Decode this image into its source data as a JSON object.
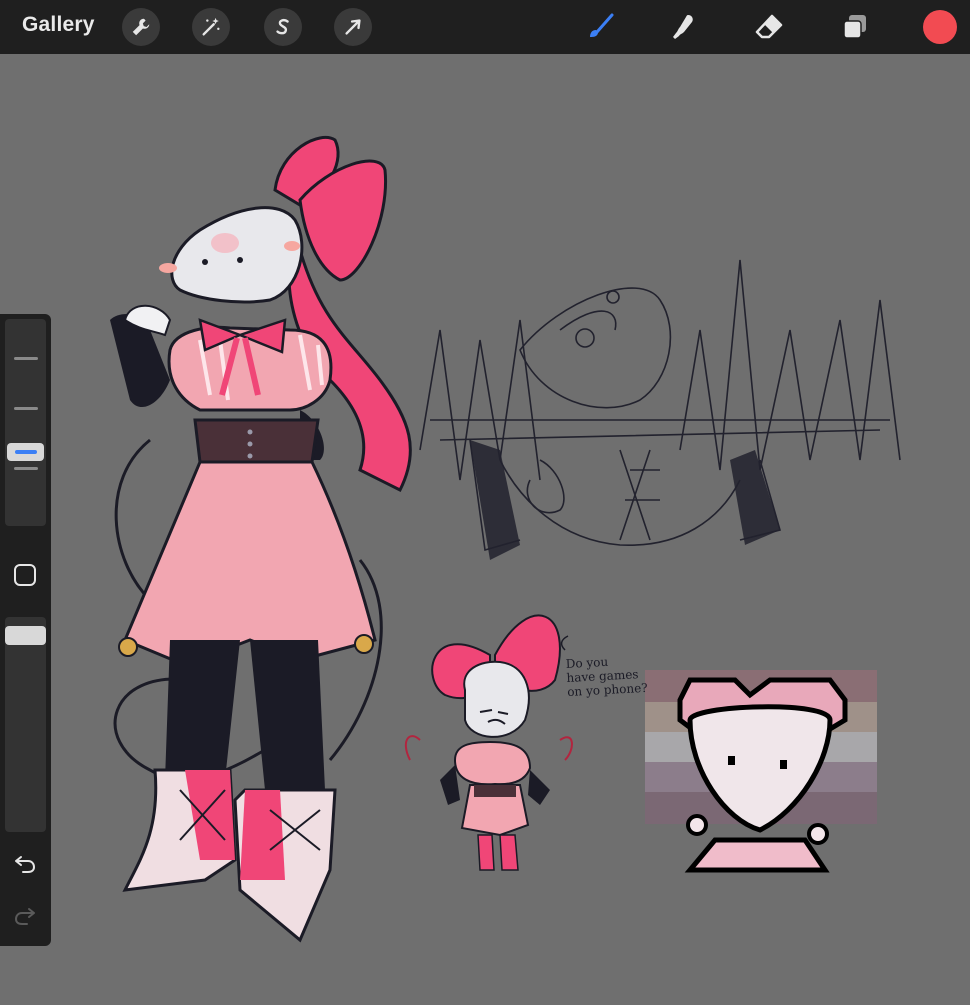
{
  "toolbar": {
    "gallery_label": "Gallery",
    "left_tools": [
      "wrench-icon",
      "magic-wand-icon",
      "selection-icon",
      "transform-arrow-icon"
    ],
    "right_tools": [
      "brush-icon",
      "smudge-icon",
      "eraser-icon",
      "layers-icon"
    ],
    "active_tool": "brush-icon",
    "brush_color": "#3b7ff5",
    "current_color": "#f24b52"
  },
  "sidebar": {
    "brush_size_level": 0.55,
    "opacity_level": 0.0,
    "buttons": [
      "modify-square-icon",
      "undo-icon",
      "redo-icon"
    ]
  },
  "canvas": {
    "background_color": "#6f6f6f",
    "handwritten_note": "Do you have games on yo phone?"
  }
}
